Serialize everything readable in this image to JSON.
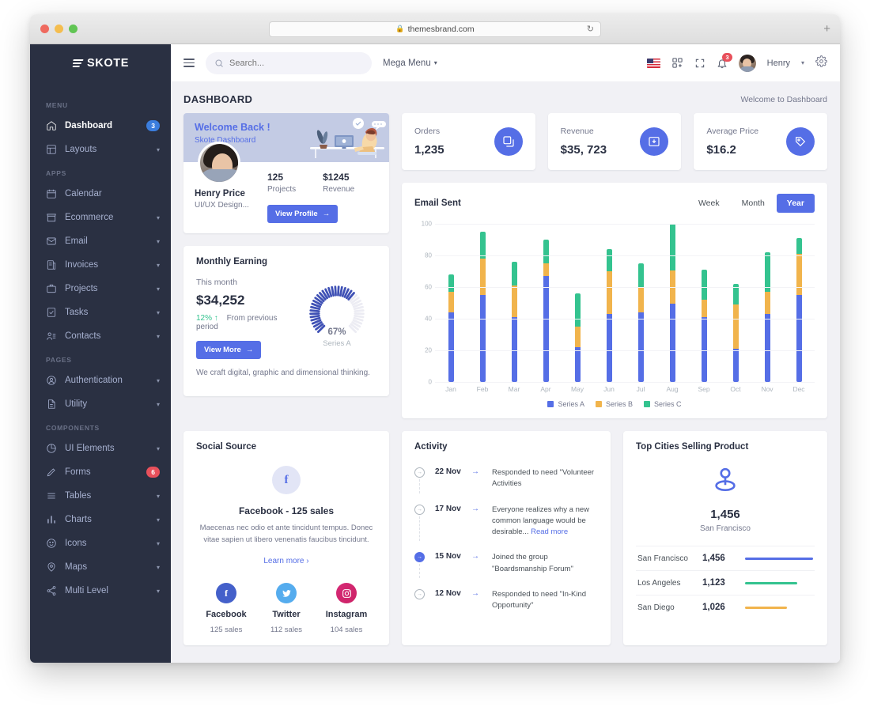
{
  "browser": {
    "url": "themesbrand.com",
    "lock_icon": "lock-icon",
    "reload_icon": "reload-icon",
    "new_tab_icon": "plus-icon"
  },
  "sidebar": {
    "brand": "SKOTE",
    "sections": [
      {
        "title": "MENU",
        "items": [
          {
            "label": "Dashboard",
            "icon": "home-icon",
            "active": true,
            "badge": "3",
            "badge_type": "info"
          },
          {
            "label": "Layouts",
            "icon": "layout-icon",
            "caret": true
          }
        ]
      },
      {
        "title": "APPS",
        "items": [
          {
            "label": "Calendar",
            "icon": "calendar-icon"
          },
          {
            "label": "Ecommerce",
            "icon": "store-icon",
            "caret": true
          },
          {
            "label": "Email",
            "icon": "mail-icon",
            "caret": true
          },
          {
            "label": "Invoices",
            "icon": "invoice-icon",
            "caret": true
          },
          {
            "label": "Projects",
            "icon": "briefcase-icon",
            "caret": true
          },
          {
            "label": "Tasks",
            "icon": "checklist-icon",
            "caret": true
          },
          {
            "label": "Contacts",
            "icon": "contacts-icon",
            "caret": true
          }
        ]
      },
      {
        "title": "PAGES",
        "items": [
          {
            "label": "Authentication",
            "icon": "user-circle-icon",
            "caret": true
          },
          {
            "label": "Utility",
            "icon": "file-icon",
            "caret": true
          }
        ]
      },
      {
        "title": "COMPONENTS",
        "items": [
          {
            "label": "UI Elements",
            "icon": "pie-icon",
            "caret": true
          },
          {
            "label": "Forms",
            "icon": "pencil-icon",
            "badge": "6",
            "badge_type": "danger"
          },
          {
            "label": "Tables",
            "icon": "list-icon",
            "caret": true
          },
          {
            "label": "Charts",
            "icon": "bar-chart-icon",
            "caret": true
          },
          {
            "label": "Icons",
            "icon": "smile-icon",
            "caret": true
          },
          {
            "label": "Maps",
            "icon": "map-pin-icon",
            "caret": true
          },
          {
            "label": "Multi Level",
            "icon": "share-icon",
            "caret": true
          }
        ]
      }
    ]
  },
  "topbar": {
    "menu_toggle_icon": "hamburger-icon",
    "search_placeholder": "Search...",
    "search_value": "",
    "search_icon": "search-icon",
    "mega_menu": "Mega Menu",
    "flag_icon": "us-flag-icon",
    "apps_icon": "apps-grid-icon",
    "fullscreen_icon": "fullscreen-icon",
    "bell_icon": "bell-icon",
    "notification_count": "3",
    "avatar": "user-avatar",
    "user_name": "Henry",
    "settings_icon": "gear-icon"
  },
  "page": {
    "title": "DASHBOARD",
    "breadcrumb": "Welcome to Dashboard"
  },
  "welcome": {
    "heading": "Welcome Back !",
    "subheading": "Skote Dashboard",
    "avatar": "profile-avatar",
    "name": "Henry Price",
    "role": "UI/UX Design...",
    "stats": [
      {
        "value": "125",
        "label": "Projects"
      },
      {
        "value": "$1245",
        "label": "Revenue"
      }
    ],
    "button": "View Profile",
    "button_icon": "arrow-right-icon",
    "illustration": "desk-working-illustration"
  },
  "stat_cards": [
    {
      "label": "Orders",
      "value": "1,235",
      "icon": "copy-icon",
      "color": "#556ee6"
    },
    {
      "label": "Revenue",
      "value": "$35, 723",
      "icon": "archive-in-icon",
      "color": "#556ee6"
    },
    {
      "label": "Average Price",
      "value": "$16.2",
      "icon": "tag-icon",
      "color": "#556ee6"
    }
  ],
  "email_sent": {
    "title": "Email Sent",
    "ranges": [
      {
        "label": "Week",
        "active": false
      },
      {
        "label": "Month",
        "active": false
      },
      {
        "label": "Year",
        "active": true
      }
    ]
  },
  "chart_data": {
    "type": "bar",
    "title": "Email Sent",
    "stacked": true,
    "categories": [
      "Jan",
      "Feb",
      "Mar",
      "Apr",
      "May",
      "Jun",
      "Jul",
      "Aug",
      "Sep",
      "Oct",
      "Nov",
      "Dec"
    ],
    "series": [
      {
        "name": "Series A",
        "color": "#556ee6",
        "values": [
          44,
          55,
          41,
          67,
          22,
          43,
          44,
          55,
          41,
          21,
          43,
          55
        ]
      },
      {
        "name": "Series B",
        "color": "#f1b44c",
        "values": [
          13,
          23,
          20,
          8,
          13,
          27,
          16,
          23,
          11,
          28,
          14,
          26
        ]
      },
      {
        "name": "Series C",
        "color": "#34c38f",
        "values": [
          11,
          17,
          15,
          15,
          21,
          14,
          15,
          33,
          19,
          13,
          25,
          10
        ]
      }
    ],
    "xlabel": "",
    "ylabel": "",
    "ylim": [
      0,
      100
    ],
    "yticks": [
      0,
      20,
      40,
      60,
      80,
      100
    ],
    "grid": true,
    "legend_position": "bottom"
  },
  "monthly_earning": {
    "title": "Monthly Earning",
    "subtitle": "This month",
    "amount": "$34,252",
    "delta": "12%",
    "delta_icon": "arrow-up-icon",
    "delta_text": "From previous period",
    "gauge_percent": "67%",
    "gauge_value": 67,
    "gauge_series": "Series A",
    "button": "View More",
    "button_icon": "arrow-right-icon",
    "footer": "We craft digital, graphic and dimensional thinking."
  },
  "social_source": {
    "title": "Social Source",
    "featured_icon": "facebook-icon",
    "featured_title": "Facebook - 125 sales",
    "description": "Maecenas nec odio et ante tincidunt tempus. Donec vitae sapien ut libero venenatis faucibus tincidunt.",
    "learn_more": "Learn more",
    "learn_more_icon": "chevron-right-icon",
    "networks": [
      {
        "name": "Facebook",
        "sales": "125 sales",
        "icon": "facebook-icon",
        "color": "#4460ca"
      },
      {
        "name": "Twitter",
        "sales": "112 sales",
        "icon": "twitter-icon",
        "color": "#55acee"
      },
      {
        "name": "Instagram",
        "sales": "104 sales",
        "icon": "instagram-icon",
        "color": "#cc2366"
      }
    ]
  },
  "activity": {
    "title": "Activity",
    "items": [
      {
        "date": "22 Nov",
        "text": "Responded to need \"Volunteer Activities",
        "active": false,
        "link": ""
      },
      {
        "date": "17 Nov",
        "text": "Everyone realizes why a new common language would be desirable...",
        "active": false,
        "link": "Read more"
      },
      {
        "date": "15 Nov",
        "text": "Joined the group \"Boardsmanship Forum\"",
        "active": true,
        "link": ""
      },
      {
        "date": "12 Nov",
        "text": "Responded to need \"In-Kind Opportunity\"",
        "active": false,
        "link": ""
      }
    ]
  },
  "top_cities": {
    "title": "Top Cities Selling Product",
    "pin_icon": "map-pin-icon",
    "featured_value": "1,456",
    "featured_city": "San Francisco",
    "rows": [
      {
        "city": "San Francisco",
        "value": "1,456",
        "percent": 100,
        "color": "#556ee6"
      },
      {
        "city": "Los Angeles",
        "value": "1,123",
        "percent": 77,
        "color": "#34c38f"
      },
      {
        "city": "San Diego",
        "value": "1,026",
        "percent": 62,
        "color": "#f1b44c"
      }
    ]
  }
}
